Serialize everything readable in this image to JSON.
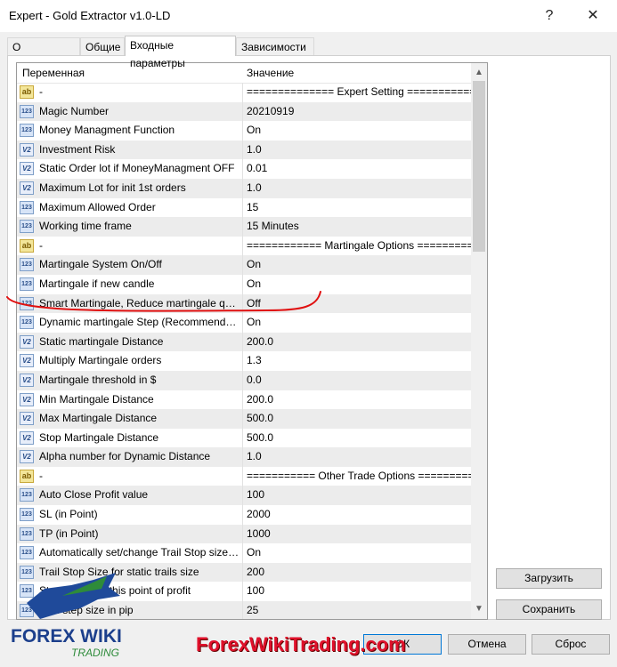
{
  "window": {
    "title": "Expert - Gold Extractor v1.0-LD",
    "help_glyph": "?",
    "close_glyph": "✕"
  },
  "tabs": [
    {
      "label": "О программе"
    },
    {
      "label": "Общие"
    },
    {
      "label": "Входные параметры"
    },
    {
      "label": "Зависимости"
    }
  ],
  "active_tab": "Входные параметры",
  "grid": {
    "col_variable": "Переменная",
    "col_value": "Значение",
    "rows": [
      {
        "icon": "ab",
        "variable": "-",
        "value": "============== Expert Setting ============="
      },
      {
        "icon": "123",
        "variable": "Magic Number",
        "value": "20210919"
      },
      {
        "icon": "123",
        "variable": "Money Managment Function",
        "value": "On"
      },
      {
        "icon": "v2",
        "variable": "Investment Risk",
        "value": "1.0"
      },
      {
        "icon": "v2",
        "variable": "Static Order lot if MoneyManagment OFF",
        "value": "0.01"
      },
      {
        "icon": "v2",
        "variable": "Maximum Lot for init 1st orders",
        "value": "1.0"
      },
      {
        "icon": "123",
        "variable": "Maximum Allowed Order",
        "value": "15"
      },
      {
        "icon": "123",
        "variable": "Working time frame",
        "value": "15 Minutes"
      },
      {
        "icon": "ab",
        "variable": "-",
        "value": "============ Martingale Options ==========="
      },
      {
        "icon": "123",
        "variable": "Martingale System On/Off",
        "value": "On"
      },
      {
        "icon": "123",
        "variable": "Martingale if new candle",
        "value": "On"
      },
      {
        "icon": "123",
        "variable": "Smart Martingale, Reduce martingale quan...",
        "value": "Off"
      },
      {
        "icon": "123",
        "variable": "Dynamic martingale Step (Recommended ...",
        "value": "On"
      },
      {
        "icon": "v2",
        "variable": "Static martingale Distance",
        "value": "200.0"
      },
      {
        "icon": "v2",
        "variable": "Multiply Martingale orders",
        "value": "1.3"
      },
      {
        "icon": "v2",
        "variable": "Martingale threshold in $",
        "value": "0.0"
      },
      {
        "icon": "v2",
        "variable": "Min Martingale Distance",
        "value": "200.0"
      },
      {
        "icon": "v2",
        "variable": "Max Martingale Distance",
        "value": "500.0"
      },
      {
        "icon": "v2",
        "variable": "Stop Martingale Distance",
        "value": "500.0"
      },
      {
        "icon": "v2",
        "variable": "Alpha number for Dynamic Distance",
        "value": "1.0"
      },
      {
        "icon": "ab",
        "variable": "-",
        "value": "=========== Other Trade Options =========="
      },
      {
        "icon": "123",
        "variable": "Auto Close Profit value",
        "value": "100"
      },
      {
        "icon": "123",
        "variable": "SL (in Point)",
        "value": "2000"
      },
      {
        "icon": "123",
        "variable": "TP (in Point)",
        "value": "1000"
      },
      {
        "icon": "123",
        "variable": "Automatically set/change Trail Stop size wi...",
        "value": "On"
      },
      {
        "icon": "123",
        "variable": "Trail Stop Size for static trails size",
        "value": "200"
      },
      {
        "icon": "123",
        "variable": "Start trail after this point of profit",
        "value": "100"
      },
      {
        "icon": "123",
        "variable": "Trail step size in pip",
        "value": "25"
      }
    ]
  },
  "buttons": {
    "load": "Загрузить",
    "save": "Сохранить",
    "ok": "ОК",
    "cancel": "Отмена",
    "reset": "Сброс"
  },
  "watermark": {
    "logo_text_1": "FOREX WIKI",
    "logo_text_2": "TRADING",
    "site": "ForexWikiTrading.com"
  },
  "colors": {
    "annotation_red": "#e01010",
    "active_button_border": "#0078d7",
    "watermark_red": "#e0112b"
  }
}
